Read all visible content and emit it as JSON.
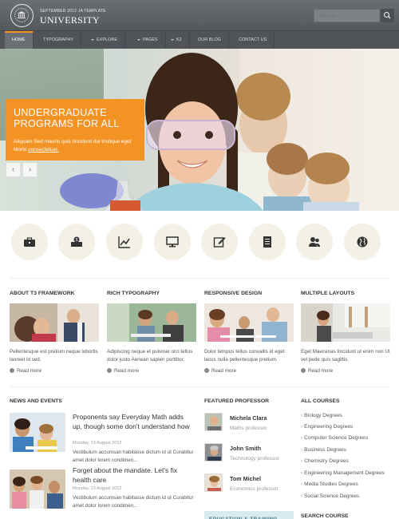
{
  "header": {
    "logo_small": "SEPTEMBER 2012 JA TEMPLATE",
    "logo_big": "UNIVERSITY",
    "seal_text": "UNIVERSITY OF HAPPINESS",
    "search_placeholder": "Search..."
  },
  "nav": {
    "items": [
      {
        "label": "HOME"
      },
      {
        "label": "TYPOGRAPHY"
      },
      {
        "label": "EXPLORE"
      },
      {
        "label": "PAGES"
      },
      {
        "label": "K2"
      },
      {
        "label": "OUR BLOG"
      },
      {
        "label": "CONTACT US"
      }
    ]
  },
  "hero": {
    "title_line1": "UNDERGRADUATE",
    "title_line2": "PROGRAMS FOR ALL",
    "text": "Aliquam Sed mauris quis tincidunt dui tristique eget Morbi",
    "link": "consectetuer."
  },
  "icons": [
    "briefcase-icon",
    "money-icon",
    "chart-icon",
    "monitor-icon",
    "edit-icon",
    "document-icon",
    "users-icon",
    "globe-icon"
  ],
  "features": [
    {
      "heading": "ABOUT T3 FRAMEWORK",
      "text": "Pellentesque est pretium neque lobortis laoreet id sed.",
      "more": "Read more"
    },
    {
      "heading": "RICH TYPOGRAPHY",
      "text": "Adipiscing neque et pulvinar orci tellus dolor justo Aenean sapien porttitor.",
      "more": "Read more"
    },
    {
      "heading": "RESPONSIVE DESIGN",
      "text": "Dolor tempus tellus convallis id eget lacus nulla pellentesque pretium.",
      "more": "Read more"
    },
    {
      "heading": "MULTIPLE LAYOUTS",
      "text": "Eget Maecenas tincidunt ut enim non Ut vel pede quis sagittis.",
      "more": "Read more"
    }
  ],
  "news": {
    "heading": "NEWS AND EVENTS",
    "items": [
      {
        "title": "Proponents say Everyday Math adds up, though some don't understand how",
        "date": "Monday, 13 August 2012",
        "text": "Vestibulum accumsan habitasse dictum id ut Curabitur amet dolor lorem condimen..."
      },
      {
        "title": "Forget about the mandate. Let's fix health care",
        "date": "Monday, 13 August 2012",
        "text": "Vestibulum accumsan habitasse dictum id ut Curabitur amet dolor lorem condimen..."
      }
    ]
  },
  "professors": {
    "heading": "FEATURED PROFESSOR",
    "items": [
      {
        "name": "Michela Clara",
        "role": "Maths professor"
      },
      {
        "name": "John Smith",
        "role": "Technology professor"
      },
      {
        "name": "Tom Michel",
        "role": "Economics professor"
      }
    ],
    "box_label": "EDUCATION & TRAINING"
  },
  "courses": {
    "heading": "ALL COURSES",
    "items": [
      "Biology Degrees",
      "Engineering Degrees",
      "Computer Science Degrees",
      "Business Degrees",
      "Chemistry Degrees",
      "Engineering Management Degrees",
      "Media Studies Degrees",
      "Social Science Degrees"
    ],
    "search_heading": "SEARCH COURSE"
  },
  "colors": {
    "accent": "#f39323",
    "header": "#5f6266",
    "icon_bg": "#f3f0e6"
  }
}
